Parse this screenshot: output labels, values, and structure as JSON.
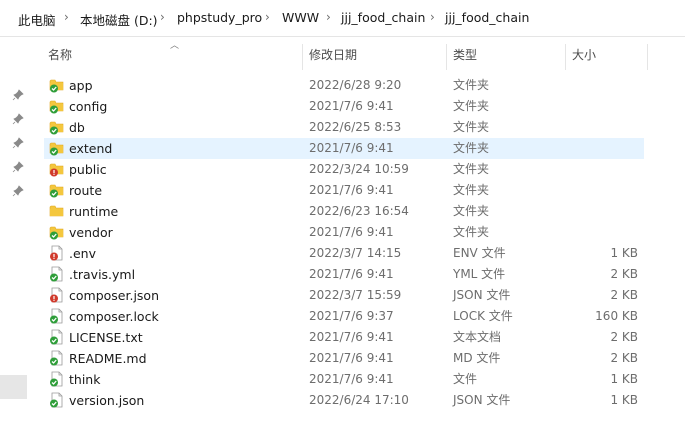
{
  "breadcrumb": [
    "此电脑",
    "本地磁盘 (D:)",
    "phpstudy_pro",
    "WWW",
    "jjj_food_chain",
    "jjj_food_chain"
  ],
  "columns": {
    "name": "名称",
    "modified": "修改日期",
    "type": "类型",
    "size": "大小"
  },
  "colors": {
    "folder": "#f4c73e",
    "folder_dark": "#e0a820",
    "sync_ok": "#2f9e3a",
    "sync_error": "#d03a2c",
    "selection": "#e5f3ff"
  },
  "files": [
    {
      "name": "app",
      "modified": "2022/6/28 9:20",
      "type": "文件夹",
      "size": "",
      "kind": "folder",
      "status": "ok"
    },
    {
      "name": "config",
      "modified": "2021/7/6 9:41",
      "type": "文件夹",
      "size": "",
      "kind": "folder",
      "status": "ok"
    },
    {
      "name": "db",
      "modified": "2022/6/25 8:53",
      "type": "文件夹",
      "size": "",
      "kind": "folder",
      "status": "ok"
    },
    {
      "name": "extend",
      "modified": "2021/7/6 9:41",
      "type": "文件夹",
      "size": "",
      "kind": "folder",
      "status": "ok",
      "selected": true
    },
    {
      "name": "public",
      "modified": "2022/3/24 10:59",
      "type": "文件夹",
      "size": "",
      "kind": "folder",
      "status": "error"
    },
    {
      "name": "route",
      "modified": "2021/7/6 9:41",
      "type": "文件夹",
      "size": "",
      "kind": "folder",
      "status": "ok"
    },
    {
      "name": "runtime",
      "modified": "2022/6/23 16:54",
      "type": "文件夹",
      "size": "",
      "kind": "folder",
      "status": "none"
    },
    {
      "name": "vendor",
      "modified": "2021/7/6 9:41",
      "type": "文件夹",
      "size": "",
      "kind": "folder",
      "status": "ok"
    },
    {
      "name": ".env",
      "modified": "2022/3/7 14:15",
      "type": "ENV 文件",
      "size": "1 KB",
      "kind": "file",
      "status": "error"
    },
    {
      "name": ".travis.yml",
      "modified": "2021/7/6 9:41",
      "type": "YML 文件",
      "size": "2 KB",
      "kind": "file",
      "status": "ok"
    },
    {
      "name": "composer.json",
      "modified": "2022/3/7 15:59",
      "type": "JSON 文件",
      "size": "2 KB",
      "kind": "file",
      "status": "error"
    },
    {
      "name": "composer.lock",
      "modified": "2021/7/6 9:37",
      "type": "LOCK 文件",
      "size": "160 KB",
      "kind": "file",
      "status": "ok"
    },
    {
      "name": "LICENSE.txt",
      "modified": "2021/7/6 9:41",
      "type": "文本文档",
      "size": "2 KB",
      "kind": "file",
      "status": "ok"
    },
    {
      "name": "README.md",
      "modified": "2021/7/6 9:41",
      "type": "MD 文件",
      "size": "2 KB",
      "kind": "file",
      "status": "ok"
    },
    {
      "name": "think",
      "modified": "2021/7/6 9:41",
      "type": "文件",
      "size": "1 KB",
      "kind": "file",
      "status": "ok"
    },
    {
      "name": "version.json",
      "modified": "2022/6/24 17:10",
      "type": "JSON 文件",
      "size": "1 KB",
      "kind": "file",
      "status": "ok"
    }
  ]
}
